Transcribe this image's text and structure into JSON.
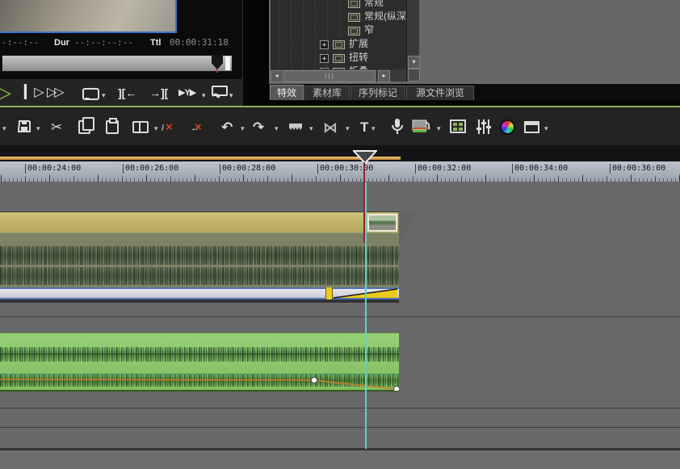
{
  "preview": {
    "tc_current": "-:--:--",
    "dur_label": "Dur",
    "dur_value": "--:--:--:--",
    "ttl_label": "Ttl",
    "ttl_value": "00:00:31:18"
  },
  "transport": {
    "play": "▷",
    "step": "▎▷",
    "ffwd": "▷▷",
    "set_in": "][←",
    "set_out": "→][",
    "around": "▶Y▶"
  },
  "glyphs": {
    "caret": "▾",
    "plus": "+",
    "scissors": "✂",
    "undo": "↶",
    "redo": "↷",
    "bowtie": "⋈",
    "title": "T",
    "x": "×",
    "slash": "/",
    "arrow_left": "←",
    "arrow_small_left": "◂",
    "arrow_small_right": "▸",
    "arrow_small_down": "▾",
    "export_arrow": "↷"
  },
  "effects": {
    "tree": [
      {
        "label": "常规"
      },
      {
        "label": "常规(纵深)"
      },
      {
        "label": "窄"
      },
      {
        "label": "扩展"
      },
      {
        "label": "扭转"
      },
      {
        "label": "折叠"
      }
    ],
    "tabs": [
      {
        "label": "特效"
      },
      {
        "label": "素材库"
      },
      {
        "label": "序列标记"
      },
      {
        "label": "源文件浏览"
      }
    ]
  },
  "timeline": {
    "ruler_labels": [
      "00:00:24:00",
      "00:00:26:00",
      "00:00:28:00",
      "00:00:30:00",
      "00:00:32:00",
      "00:00:34:00",
      "00:00:36:00"
    ]
  },
  "colors": {
    "accent_green": "#8fb062",
    "playhead_cyan": "#5fd2cc",
    "playhead_red": "#8e2430",
    "io_bar_orange": "#d99a3e",
    "video_clip": "#c3b76a",
    "audio_clip": "#8cc86e",
    "rubber_band": "#cf7d2a",
    "keyframe_yellow": "#e8cd1e",
    "selection_blue": "#4e74b4"
  }
}
